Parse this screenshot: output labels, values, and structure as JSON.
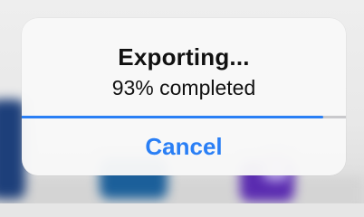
{
  "dialog": {
    "title": "Exporting...",
    "message": "93% completed",
    "progress_fraction": 0.93,
    "cancel_label": "Cancel"
  },
  "colors": {
    "accent": "#2a7ff5",
    "track": "#c9c9cc",
    "dialog_background": "#f8f8f8",
    "text": "#111111"
  }
}
